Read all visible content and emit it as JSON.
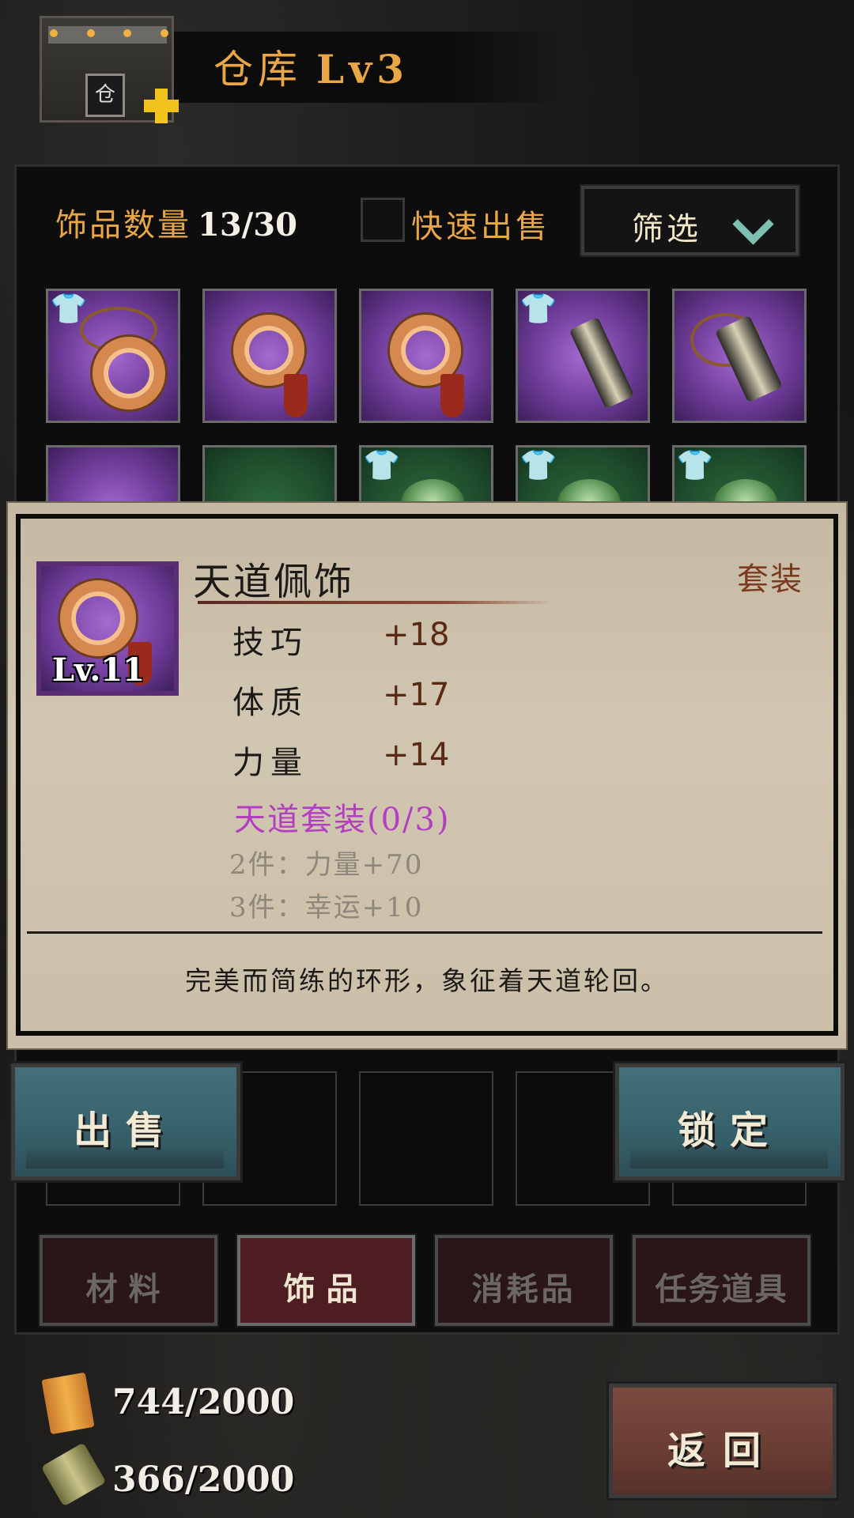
{
  "header": {
    "title": "仓库",
    "level": "Lv3",
    "building_icon": "warehouse-icon",
    "upgrade_icon": "plus-icon"
  },
  "inventory": {
    "count_label": "饰品数量",
    "count_value": "13/30",
    "quick_sell_label": "快速出售",
    "quick_sell_checked": false,
    "filter_label": "筛选"
  },
  "detail": {
    "level": "Lv.11",
    "name": "天道佩饰",
    "tag": "套装",
    "stats": [
      {
        "name": "技巧",
        "value": "+18"
      },
      {
        "name": "体质",
        "value": "+17"
      },
      {
        "name": "力量",
        "value": "+14"
      }
    ],
    "set_name": "天道套装(0/3)",
    "set_bonuses": [
      "2件：力量+70",
      "3件：幸运+10"
    ],
    "description": "完美而简练的环形，象征着天道轮回。"
  },
  "actions": {
    "sell_label": "出售",
    "lock_label": "锁定"
  },
  "tabs": [
    {
      "label": "材料",
      "active": false
    },
    {
      "label": "饰品",
      "active": true
    },
    {
      "label": "消耗品",
      "active": false
    },
    {
      "label": "任务道具",
      "active": false
    }
  ],
  "resources": [
    {
      "icon": "scroll-icon",
      "value": "744/2000"
    },
    {
      "icon": "paper-roll-icon",
      "value": "366/2000"
    }
  ],
  "back_label": "返回",
  "colors": {
    "accent_orange": "#e9a646",
    "set_purple": "#b43ec1",
    "rarity_purple": "#6e3c99",
    "rarity_green": "#1f4d2c",
    "action_teal": "#43707a",
    "back_red": "#7b4a3f"
  }
}
